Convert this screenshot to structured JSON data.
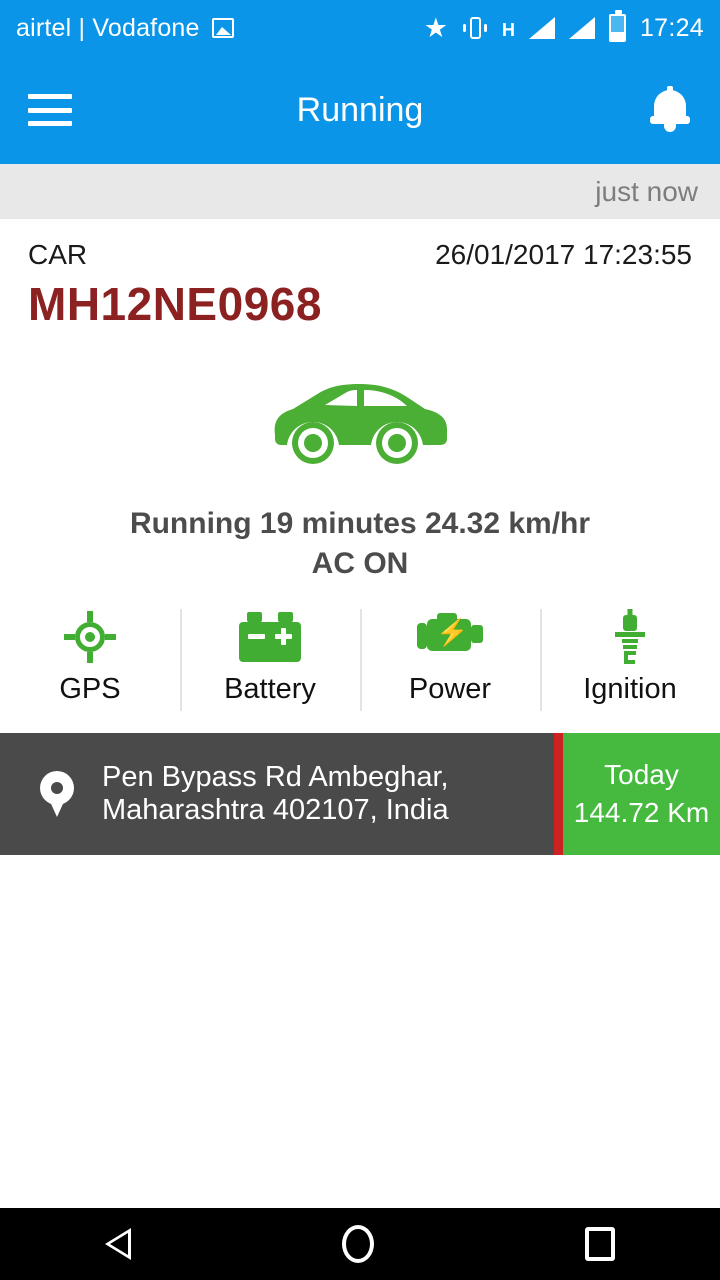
{
  "status_bar": {
    "carrier": "airtel | Vodafone",
    "image_icon": "image-icon",
    "star_icon": "★",
    "vibrate_icon": "vibrate-icon",
    "network_type": "H",
    "signal_icon": "signal-bars-icon",
    "battery_icon": "battery-icon",
    "time": "17:24"
  },
  "app_bar": {
    "menu_icon": "hamburger-menu-icon",
    "title": "Running",
    "notification_icon": "bell-icon"
  },
  "banner": {
    "updated_text": "just now"
  },
  "vehicle": {
    "type": "CAR",
    "timestamp": "26/01/2017 17:23:55",
    "plate": "MH12NE0968",
    "plate_color": "#8b2121",
    "image": "green-car-side-icon",
    "status_line": "Running 19 minutes 24.32 km/hr",
    "ac_status": "AC ON"
  },
  "indicators": [
    {
      "icon": "gps-crosshair-icon",
      "label": "GPS",
      "color": "#42ad33"
    },
    {
      "icon": "car-battery-icon",
      "label": "Battery",
      "color": "#42ad33"
    },
    {
      "icon": "engine-power-icon",
      "label": "Power",
      "color": "#42ad33"
    },
    {
      "icon": "spark-plug-icon",
      "label": "Ignition",
      "color": "#42ad33"
    }
  ],
  "location": {
    "pin_icon": "map-pin-icon",
    "address_line1": "Pen Bypass Rd Ambeghar,",
    "address_line2": "Maharashtra 402107, India",
    "divider_color": "#cc2222",
    "summary_label": "Today",
    "summary_value": "144.72 Km",
    "summary_color": "#45ba3f"
  },
  "nav_bar": {
    "back_icon": "back-triangle-icon",
    "home_icon": "home-circle-icon",
    "recents_icon": "recents-square-icon"
  },
  "theme": {
    "primary": "#0a95e8",
    "accent_green": "#42ad33",
    "dark_panel": "#4a4a4a"
  }
}
